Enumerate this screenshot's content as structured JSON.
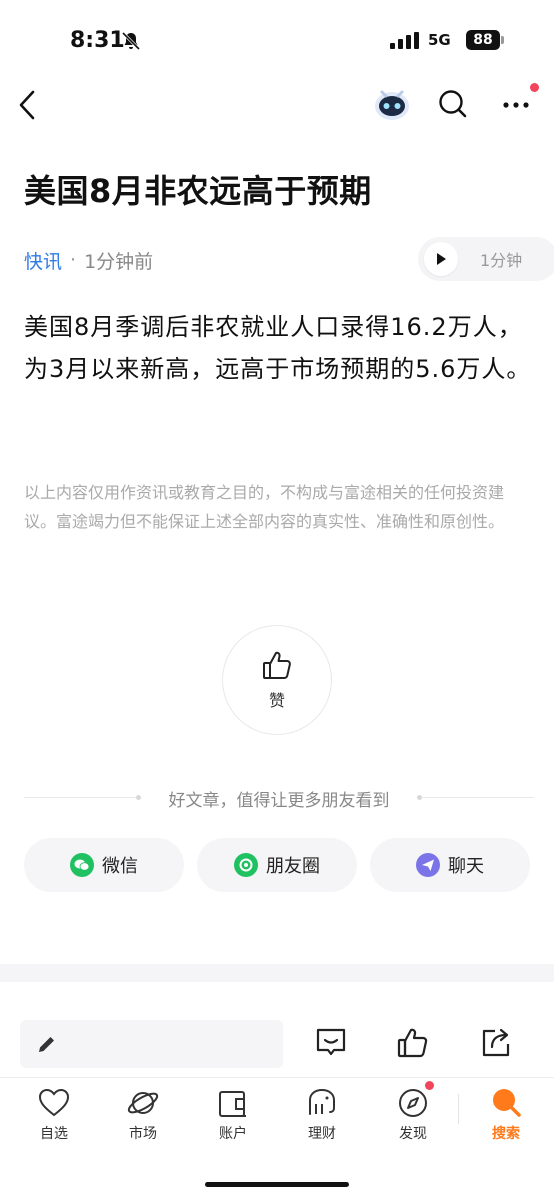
{
  "status_bar": {
    "time": "8:31",
    "network": "5G",
    "battery": "88"
  },
  "nav": {
    "back_icon": "chevron-left-icon",
    "bot_icon": "robot-assistant-icon",
    "search_icon": "search-icon",
    "more_icon": "more-dots-icon"
  },
  "article": {
    "title": "美国8月非农远高于预期",
    "source": "快讯",
    "time_ago": "1分钟前",
    "audio_duration": "1分钟",
    "body": "美国8月季调后非农就业人口录得16.2万人，为3月以来新高，远高于市场预期的5.6万人。",
    "disclaimer": "以上内容仅用作资讯或教育之目的，不构成与富途相关的任何投资建议。富途竭力但不能保证上述全部内容的真实性、准确性和原创性。"
  },
  "like": {
    "label": "赞"
  },
  "share": {
    "prompt": "好文章，值得让更多朋友看到",
    "buttons": [
      {
        "label": "微信",
        "icon": "wechat-icon",
        "color": "#1fc160"
      },
      {
        "label": "朋友圈",
        "icon": "moments-icon",
        "color": "#1fc160"
      },
      {
        "label": "聊天",
        "icon": "chat-send-icon",
        "color": "#7b74e8"
      }
    ]
  },
  "toolbar": {
    "icons": [
      "pencil-icon",
      "comment-icon",
      "thumbs-up-icon",
      "share-icon"
    ]
  },
  "tabbar": {
    "tabs": [
      {
        "label": "自选",
        "icon": "heart-icon"
      },
      {
        "label": "市场",
        "icon": "planet-icon"
      },
      {
        "label": "账户",
        "icon": "wallet-icon"
      },
      {
        "label": "理财",
        "icon": "elephant-icon"
      },
      {
        "label": "发现",
        "icon": "compass-icon"
      },
      {
        "label": "搜索",
        "icon": "search-icon",
        "active": true
      }
    ],
    "active_color": "#ff7a1a"
  }
}
